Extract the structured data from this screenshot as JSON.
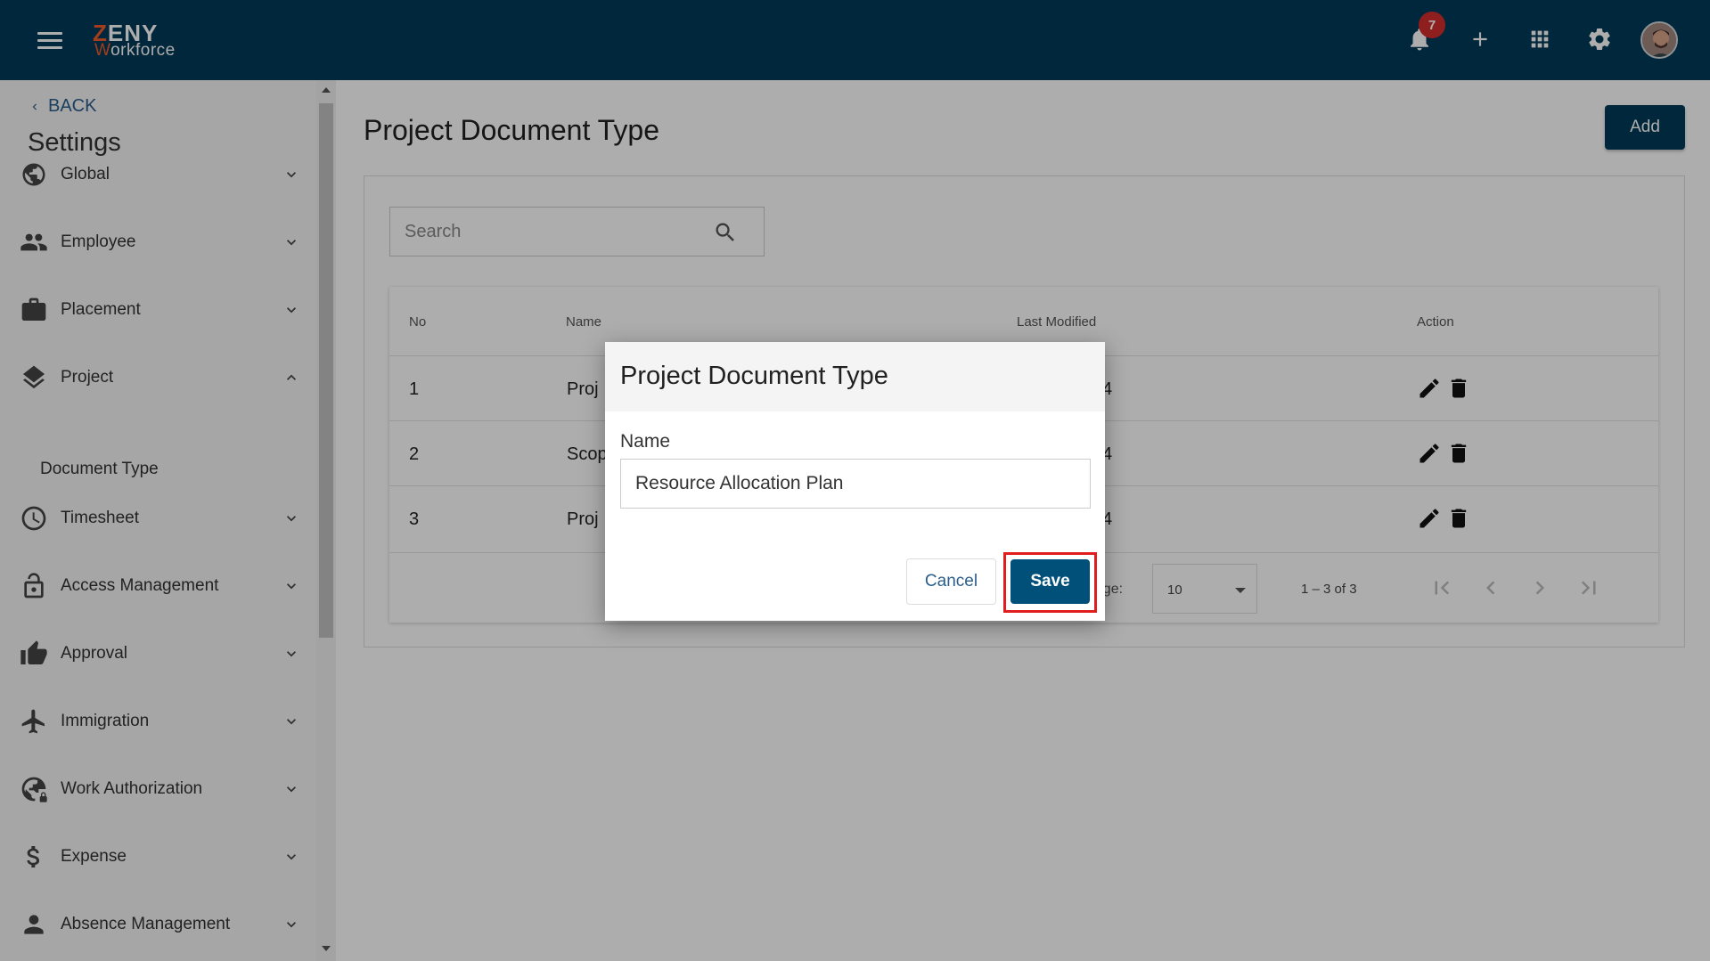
{
  "header": {
    "logo_text_1": "ZENY",
    "logo_text_1_first": "Z",
    "logo_text_2": "orkforce",
    "logo_text_2_first": "W",
    "notification_count": "7",
    "brand_color": "#003a57",
    "accent_color": "#f15a29",
    "icons": [
      "menu-icon",
      "bell-icon",
      "plus-icon",
      "apps-grid-icon",
      "gear-icon",
      "avatar"
    ]
  },
  "sidebar": {
    "back_label": "BACK",
    "title": "Settings",
    "items": [
      {
        "label": "Global",
        "icon": "globe-icon",
        "expanded": false
      },
      {
        "label": "Employee",
        "icon": "people-icon",
        "expanded": false
      },
      {
        "label": "Placement",
        "icon": "briefcase-icon",
        "expanded": false
      },
      {
        "label": "Project",
        "icon": "layers-icon",
        "expanded": true
      },
      {
        "label": "Timesheet",
        "icon": "clock-icon",
        "expanded": false
      },
      {
        "label": "Access Management",
        "icon": "lock-icon",
        "expanded": false
      },
      {
        "label": "Approval",
        "icon": "thumbs-up-icon",
        "expanded": false
      },
      {
        "label": "Immigration",
        "icon": "airplane-icon",
        "expanded": false
      },
      {
        "label": "Work Authorization",
        "icon": "globe-lock-icon",
        "expanded": false
      },
      {
        "label": "Expense",
        "icon": "dollar-icon",
        "expanded": false
      },
      {
        "label": "Absence Management",
        "icon": "person-icon",
        "expanded": false
      }
    ],
    "sub_item": "Document Type"
  },
  "main": {
    "title": "Project Document Type",
    "add_label": "Add",
    "search_placeholder": "Search",
    "table": {
      "headers": [
        "No",
        "Name",
        "Last Modified",
        "Action"
      ],
      "rows": [
        {
          "no": "1",
          "name": "Proj",
          "modified": "4"
        },
        {
          "no": "2",
          "name": "Scop",
          "modified": "4"
        },
        {
          "no": "3",
          "name": "Proj",
          "modified": "4"
        }
      ],
      "items_per_page_label": "page:",
      "items_per_page": "10",
      "range": "1 – 3 of 3"
    }
  },
  "dialog": {
    "title": "Project Document Type",
    "field_label": "Name",
    "field_value": "Resource Allocation Plan",
    "cancel_label": "Cancel",
    "save_label": "Save"
  }
}
